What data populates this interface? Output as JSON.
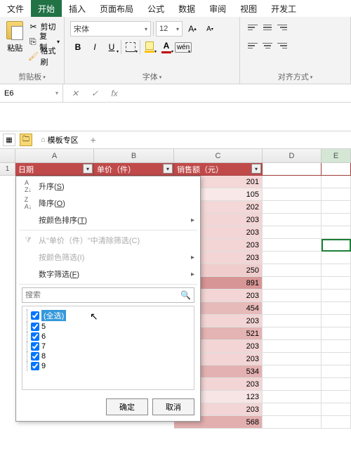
{
  "tabs": [
    "文件",
    "开始",
    "插入",
    "页面布局",
    "公式",
    "数据",
    "审阅",
    "视图",
    "开发工"
  ],
  "active_tab": 1,
  "ribbon": {
    "clipboard": {
      "paste": "粘贴",
      "cut": "剪切",
      "copy": "复制",
      "formatPainter": "格式刷",
      "group": "剪贴板"
    },
    "font": {
      "name": "宋体",
      "size": "12",
      "bold": "B",
      "italic": "I",
      "underline": "U",
      "wen": "wén",
      "group": "字体"
    },
    "align": {
      "group": "对齐方式"
    }
  },
  "namebox": "E6",
  "sheet_tabs": {
    "template": "模板专区"
  },
  "columns": [
    "A",
    "B",
    "C",
    "D",
    "E"
  ],
  "header_row": {
    "a": "日期",
    "b": "单价（件）",
    "c": "销售额（元）"
  },
  "row1_label": "1",
  "c_values": [
    201,
    105,
    202,
    203,
    203,
    203,
    203,
    250,
    891,
    203,
    454,
    203,
    521,
    203,
    203,
    534,
    203,
    123,
    203,
    568
  ],
  "filter_menu": {
    "asc": "升序",
    "asc_key": "S",
    "desc": "降序",
    "desc_key": "O",
    "color_sort": "按颜色排序",
    "color_sort_key": "T",
    "clear": "从\"单价（件）\"中清除筛选",
    "clear_key": "C",
    "color_filter": "按颜色筛选",
    "color_filter_key": "I",
    "num_filter": "数字筛选",
    "num_filter_key": "F",
    "search_ph": "搜索",
    "select_all": "(全选)",
    "items": [
      "5",
      "6",
      "7",
      "8",
      "9"
    ],
    "ok": "确定",
    "cancel": "取消"
  }
}
